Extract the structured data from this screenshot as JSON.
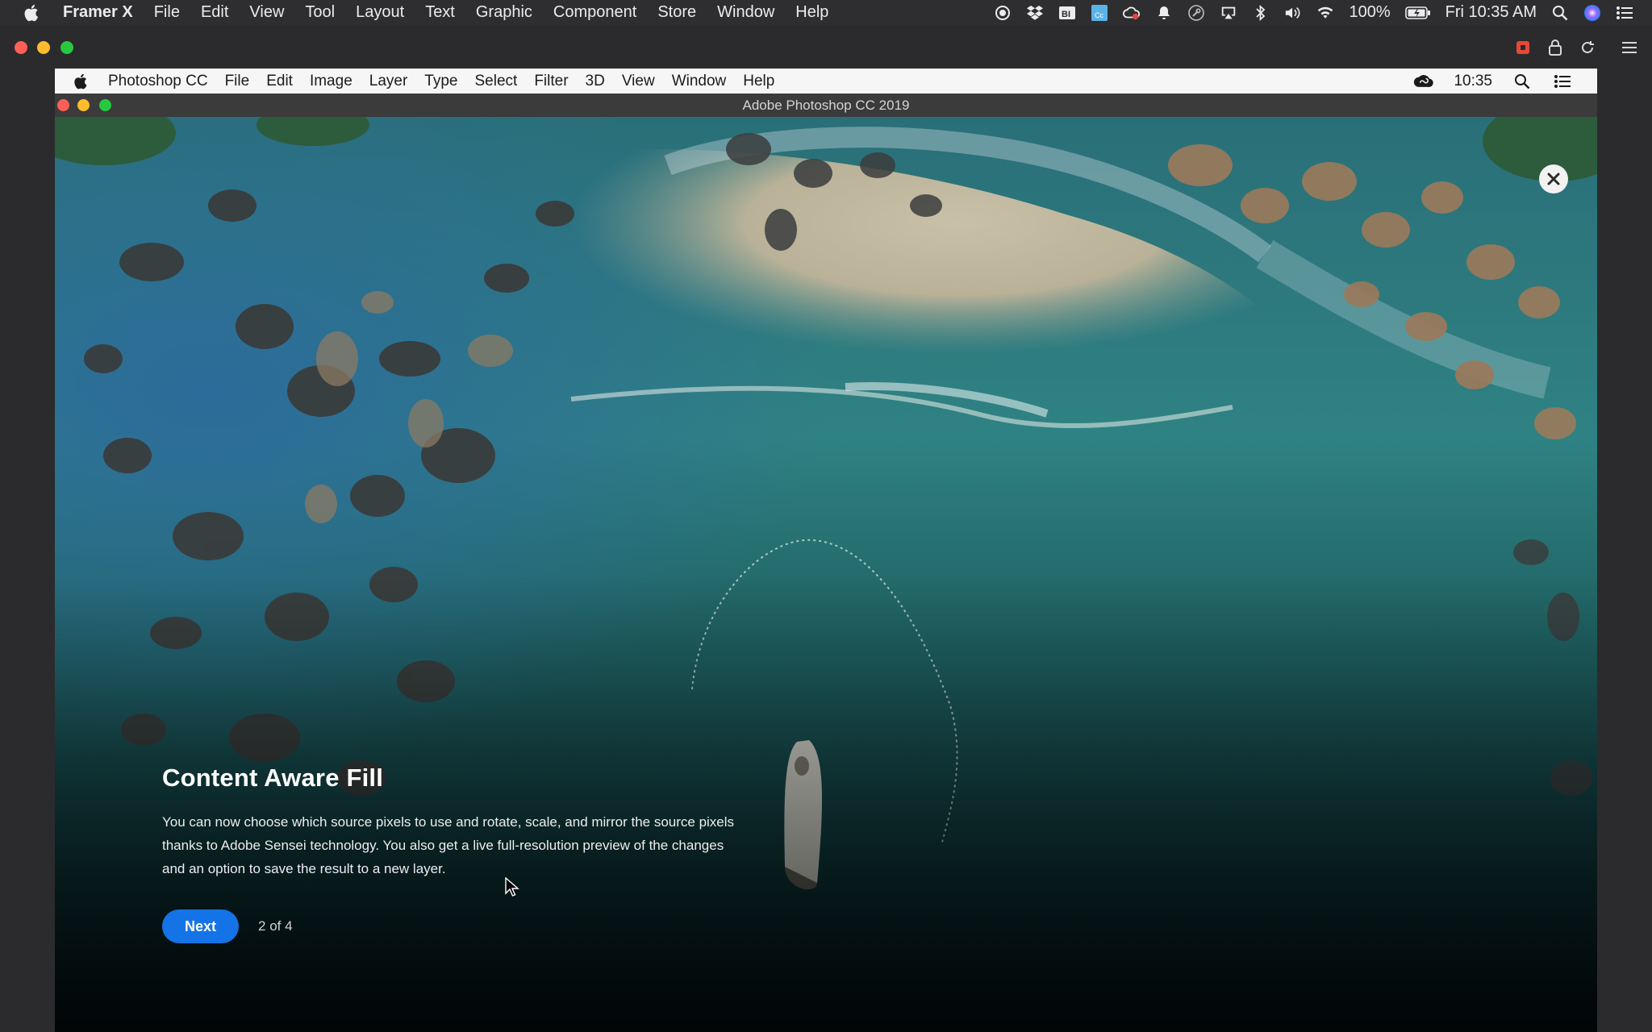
{
  "mac_menubar": {
    "app_name": "Framer X",
    "menus": [
      "File",
      "Edit",
      "View",
      "Tool",
      "Layout",
      "Text",
      "Graphic",
      "Component",
      "Store",
      "Window",
      "Help"
    ],
    "battery": "100%",
    "clock": "Fri 10:35 AM",
    "status_icons": [
      "record-icon",
      "dropbox-icon",
      "bartender-icon",
      "creative-cloud-badge-icon",
      "cloud-sync-icon",
      "notification-bell-icon",
      "spotlight-helper-icon",
      "airplay-icon",
      "bluetooth-icon",
      "volume-icon",
      "wifi-icon",
      "battery-icon",
      "search-icon",
      "siri-icon",
      "notification-center-icon"
    ]
  },
  "framer_toolbar": {
    "icons": [
      "record-stop-icon",
      "lock-icon",
      "refresh-icon",
      "menu-icon"
    ]
  },
  "ps_menubar": {
    "app_name": "Photoshop CC",
    "menus": [
      "File",
      "Edit",
      "Image",
      "Layer",
      "Type",
      "Select",
      "Filter",
      "3D",
      "View",
      "Window",
      "Help"
    ],
    "clock": "10:35"
  },
  "ps_window": {
    "title": "Adobe Photoshop CC 2019"
  },
  "feature": {
    "title": "Content Aware Fill",
    "description": "You can now choose which source pixels to use and rotate, scale, and mirror the source pixels thanks to Adobe Sensei technology. You also get a live full-resolution preview of the changes and an option to save the result to a new layer.",
    "next_label": "Next",
    "page_indicator": "2 of 4"
  },
  "colors": {
    "accent": "#1473e6",
    "host_bg": "#2b2b2d",
    "water": "#0d3a3c"
  }
}
